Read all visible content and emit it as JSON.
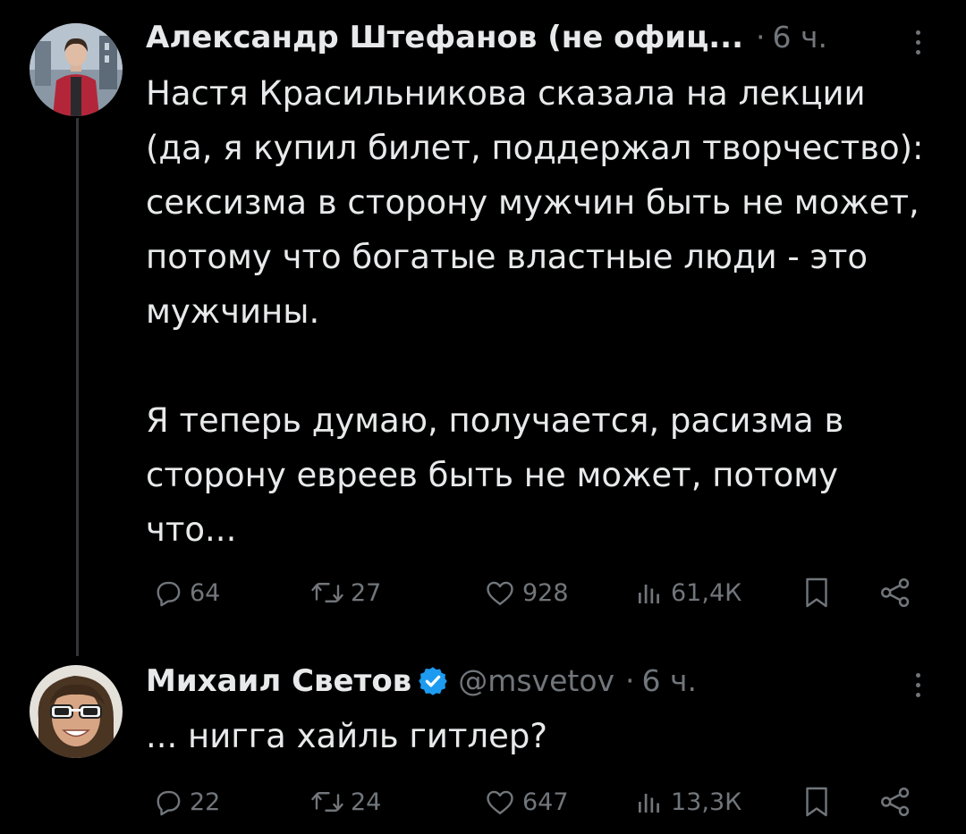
{
  "tweets": [
    {
      "author_name": "Александр Штефанов (не офиц...",
      "separator": "·",
      "time": "6 ч.",
      "body": "Настя Красильникова сказала на лекции (да, я купил билет, поддержал творчество): сексизма в сторону мужчин быть не может, потому что богатые властные люди - это мужчины.\n\nЯ теперь думаю,  получается, расизма в сторону евреев быть не может, потому что...",
      "replies": "64",
      "reposts": "27",
      "likes": "928",
      "views": "61,4К"
    },
    {
      "author_name": "Михаил Светов",
      "verified": true,
      "handle": "@msvetov",
      "separator": "·",
      "time": "6 ч.",
      "body": "... нигга хайль гитлер?",
      "replies": "22",
      "reposts": "24",
      "likes": "647",
      "views": "13,3К"
    }
  ],
  "icons": {
    "reply": "reply-icon",
    "repost": "repost-icon",
    "like": "heart-icon",
    "views": "views-icon",
    "bookmark": "bookmark-icon",
    "share": "share-icon",
    "more": "more-icon",
    "verified": "verified-badge-icon"
  },
  "colors": {
    "background": "#000000",
    "text": "#e7e9ea",
    "secondary": "#71767b",
    "verified": "#1d9bf0",
    "thread_line": "#333639"
  }
}
